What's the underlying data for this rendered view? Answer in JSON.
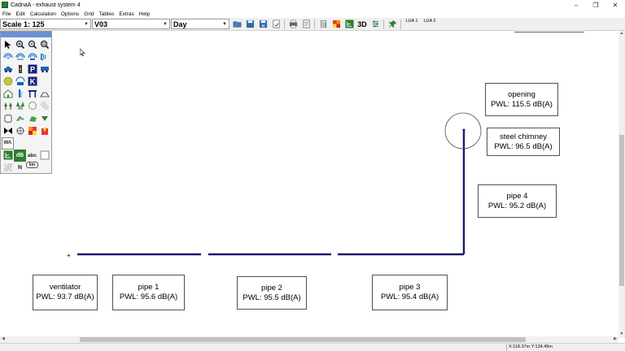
{
  "window": {
    "title": "CadnaA - exhaust system 4",
    "minimize": "–",
    "maximize": "❐",
    "close": "✕"
  },
  "menu": [
    "File",
    "Edit",
    "Calculation",
    "Options",
    "Grid",
    "Tables",
    "Extras",
    "Help"
  ],
  "toolbar": {
    "scale_label": "Scale 1: 125",
    "variant_value": "V03",
    "period_value": "Day",
    "lua1": "LUA 1",
    "lua2": "LUA 2",
    "view3d": "3D"
  },
  "palette": {
    "dB": "dB",
    "abc": "abc",
    "K": "K",
    "P": "P",
    "WA": "WA",
    "N": "N",
    "km": "km"
  },
  "labels": [
    {
      "name": "ventilator",
      "title": "ventilator",
      "pwl": "PWL: 93.7 dB(A)"
    },
    {
      "name": "pipe-1",
      "title": "pipe 1",
      "pwl": "PWL: 95.6 dB(A)"
    },
    {
      "name": "pipe-2",
      "title": "pipe 2",
      "pwl": "PWL: 95.5 dB(A)"
    },
    {
      "name": "pipe-3",
      "title": "pipe 3",
      "pwl": "PWL: 95.4 dB(A)"
    },
    {
      "name": "pipe-4",
      "title": "pipe 4",
      "pwl": "PWL: 95.2 dB(A)"
    },
    {
      "name": "steel-chimney",
      "title": "steel chimney",
      "pwl": "PWL: 96.5 dB(A)"
    },
    {
      "name": "opening",
      "title": "opening",
      "pwl": "PWL: 115.5 dB(A)"
    }
  ],
  "status": {
    "coordinates": "X:118.37m Y:134.49m"
  },
  "colors": {
    "pipe": "#1a1a6e",
    "palette_header": "#6b8fd6"
  }
}
